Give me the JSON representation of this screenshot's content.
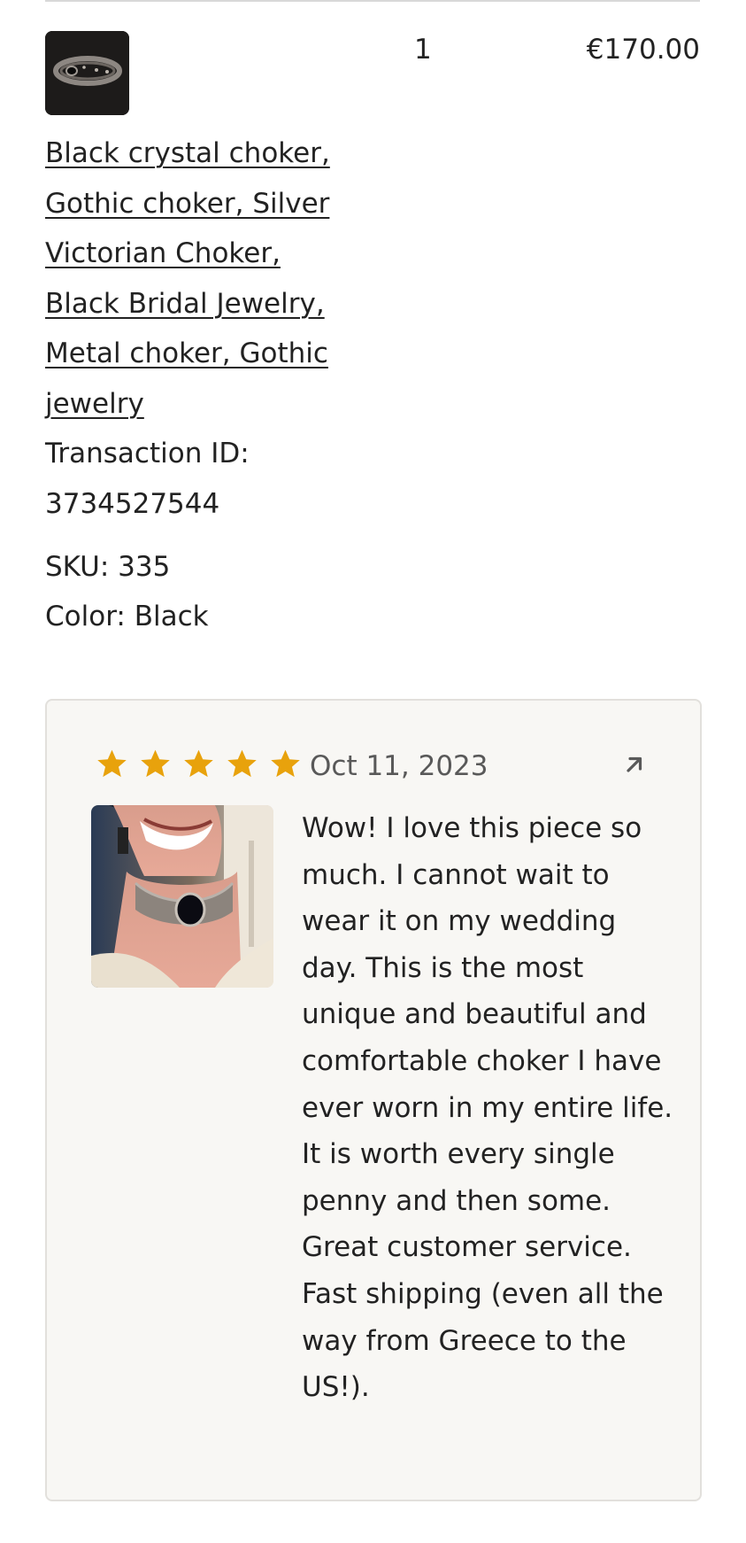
{
  "order_item": {
    "quantity": "1",
    "price": "€170.00",
    "product_title": "Black crystal choker, Gothic choker, Silver Victorian Choker, Black Bridal Jewelry, Metal choker, Gothic jewelry",
    "transaction_label": "Transaction ID: 3734527544",
    "sku_label": "SKU: 335",
    "color_label": "Color: Black",
    "thumbnail_icon": "choker-thumbnail"
  },
  "review": {
    "rating": 5,
    "rating_max": 5,
    "star_color": "#e8a20c",
    "date": "Oct 11, 2023",
    "open_icon": "arrow-up-right-icon",
    "photo_icon": "review-photo",
    "text": "Wow! I love this piece so much. I cannot wait to wear it on my wedding day. This is the most unique and beautiful and comfortable choker I have ever worn in my entire life. It is worth every single penny and then some. Great customer service. Fast shipping (even all the way from Greece to the US!)."
  }
}
